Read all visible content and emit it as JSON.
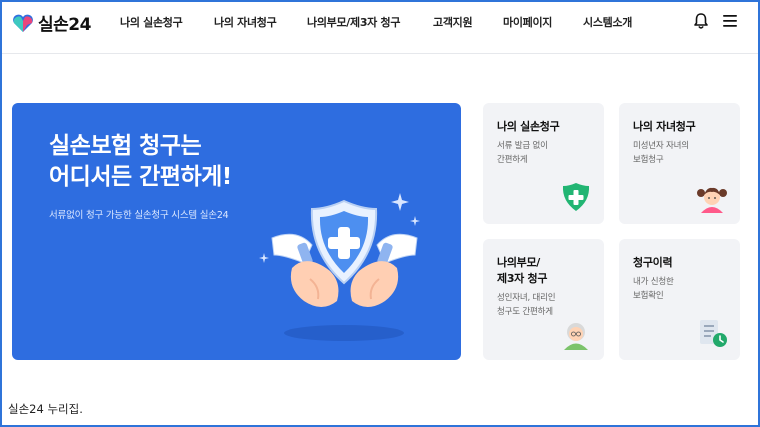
{
  "brand": {
    "name": "실손24"
  },
  "nav": [
    "나의 실손청구",
    "나의 자녀청구",
    "나의부모/제3자 청구",
    "고객지원",
    "마이페이지",
    "시스템소개"
  ],
  "icons": {
    "notifications": "bell-icon",
    "menu": "hamburger-menu-icon"
  },
  "hero": {
    "title_line1": "실손보험 청구는",
    "title_line2": "어디서든 간편하게!",
    "subtitle": "서류없이 청구 가능한 실손청구 시스템 실손24"
  },
  "cards": [
    {
      "title_lines": [
        "나의 실손청구"
      ],
      "desc_lines": [
        "서류 발급 없이",
        "간편하게"
      ],
      "icon": "green-shield-plus-icon"
    },
    {
      "title_lines": [
        "나의 자녀청구"
      ],
      "desc_lines": [
        "미성년자 자녀의",
        "보험청구"
      ],
      "icon": "child-avatar-icon"
    },
    {
      "title_lines": [
        "나의부모/",
        "제3자 청구"
      ],
      "desc_lines": [
        "성인자녀, 대리인",
        "청구도 간편하게"
      ],
      "icon": "elder-avatar-icon"
    },
    {
      "title_lines": [
        "청구이력"
      ],
      "desc_lines": [
        "내가 신청한",
        "보험확인"
      ],
      "icon": "document-clock-icon"
    }
  ],
  "caption": "실손24 누리집.",
  "colors": {
    "accent": "#2e6de0",
    "card_bg": "#f2f3f6",
    "frame": "#2f74d9",
    "shield_green": "#22b573"
  }
}
